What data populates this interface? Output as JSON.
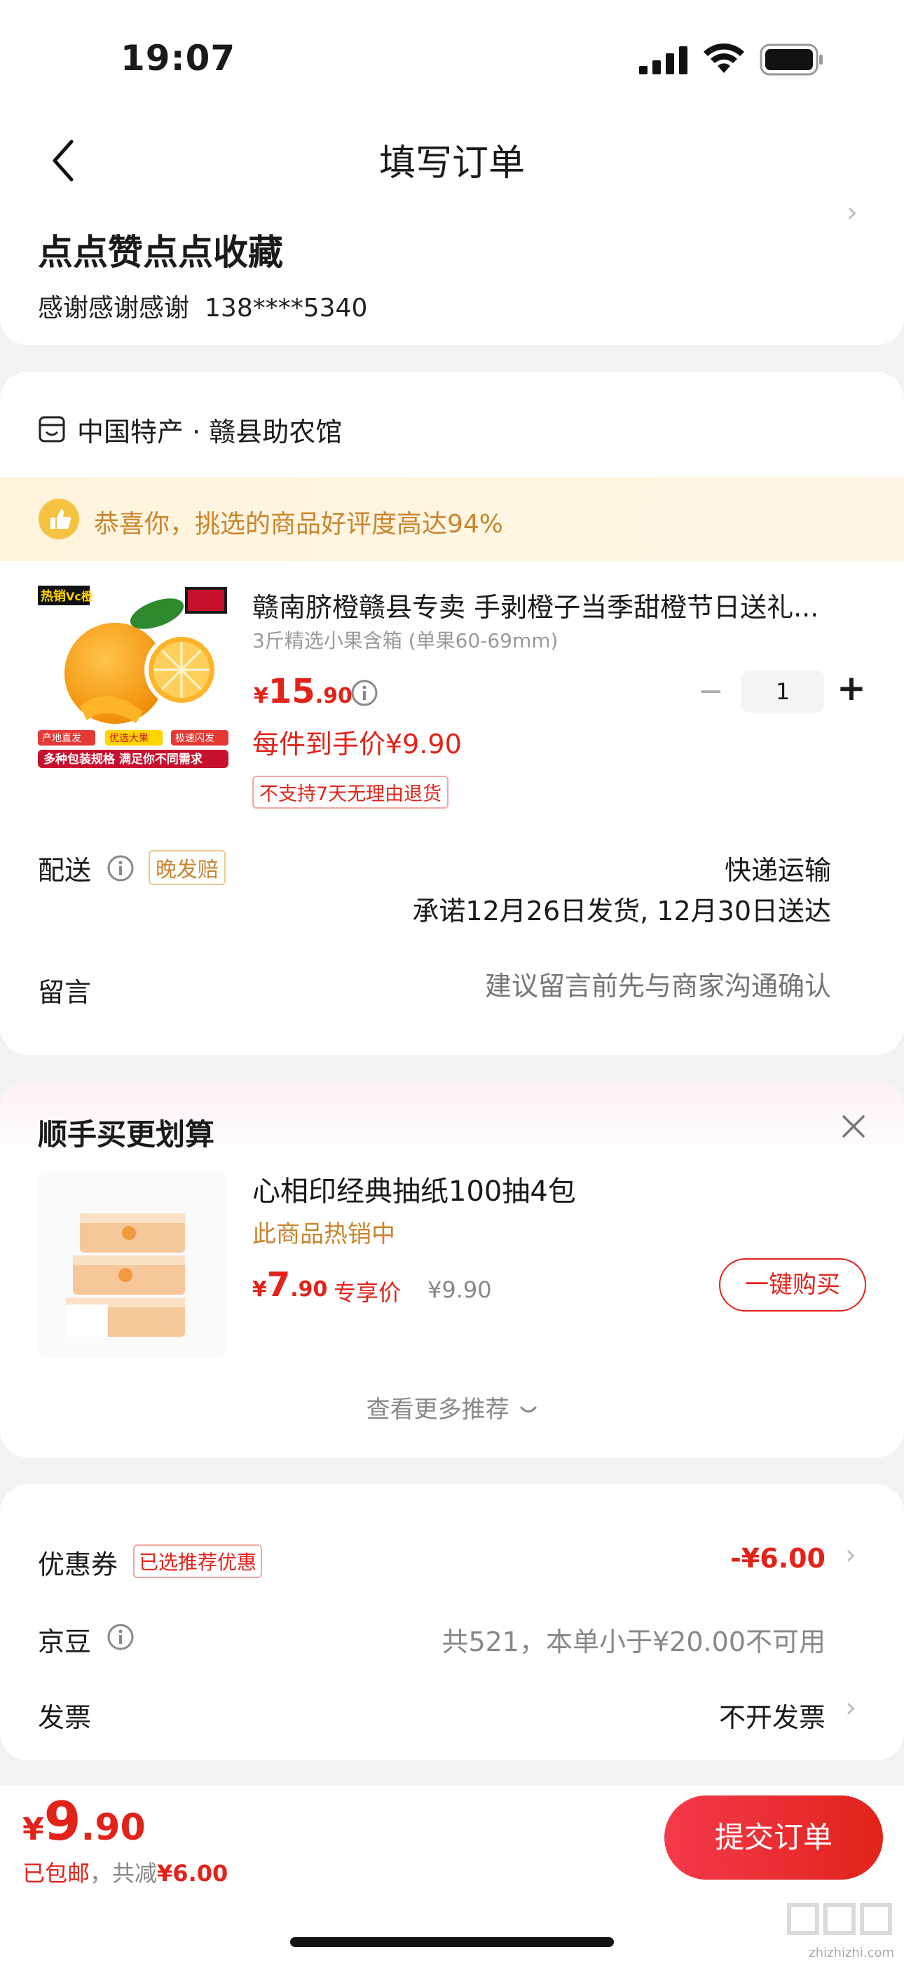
{
  "status_bar": {
    "time": "19:07"
  },
  "nav": {
    "title": "填写订单"
  },
  "address": {
    "name": "点点赞点点收藏",
    "recipient": "感谢感谢感谢",
    "phone": "138****5340"
  },
  "shop": {
    "name": "中国特产 · 赣县助农馆",
    "banner": "恭喜你，挑选的商品好评度高达94%",
    "product": {
      "title": "赣南脐橙赣县专卖 手剥橙子当季甜橙节日送礼...",
      "spec": "3斤精选小果含箱 (单果60-69mm)",
      "price_currency": "¥",
      "price_int": "15",
      "price_dec": ".90",
      "quantity": "1",
      "net_price": "每件到手价¥9.90",
      "return_policy": "不支持7天无理由退货",
      "image_labels": {
        "hot": "热销",
        "vc": "Vc橙",
        "origin": "产地直发",
        "select": "优选大果",
        "fast": "极速闪发",
        "slogan": "多种包装规格 满足你不同需求"
      }
    },
    "delivery": {
      "label": "配送",
      "tag": "晚发赔",
      "method": "快递运输",
      "promise": "承诺12月26日发货, 12月30日送达"
    },
    "message": {
      "label": "留言",
      "placeholder": "建议留言前先与商家沟通确认"
    }
  },
  "recommend": {
    "title": "顺手买更划算",
    "item": {
      "name": "心相印经典抽纸100抽4包",
      "hot": "此商品热销中",
      "price_currency": "¥",
      "price_int": "7",
      "price_dec": ".90",
      "exclusive_label": "专享价",
      "original_price": "¥9.90",
      "buy_label": "一键购买"
    },
    "more_label": "查看更多推荐"
  },
  "fees": {
    "coupon": {
      "label": "优惠券",
      "tag": "已选推荐优惠",
      "value": "-¥6.00"
    },
    "beans": {
      "label": "京豆",
      "value": "共521，本单小于¥20.00不可用"
    },
    "invoice": {
      "label": "发票",
      "value": "不开发票"
    }
  },
  "footer": {
    "total_currency": "¥",
    "total_int": "9",
    "total_dec": ".90",
    "shipping": "已包邮",
    "saved_prefix": "，共减",
    "saved_amount": "¥6.00",
    "submit_label": "提交订单",
    "watermark": "zhizhizhi.com"
  },
  "colors": {
    "accent": "#e2231a",
    "gold": "#c8852e",
    "background": "#f2f2f2"
  }
}
